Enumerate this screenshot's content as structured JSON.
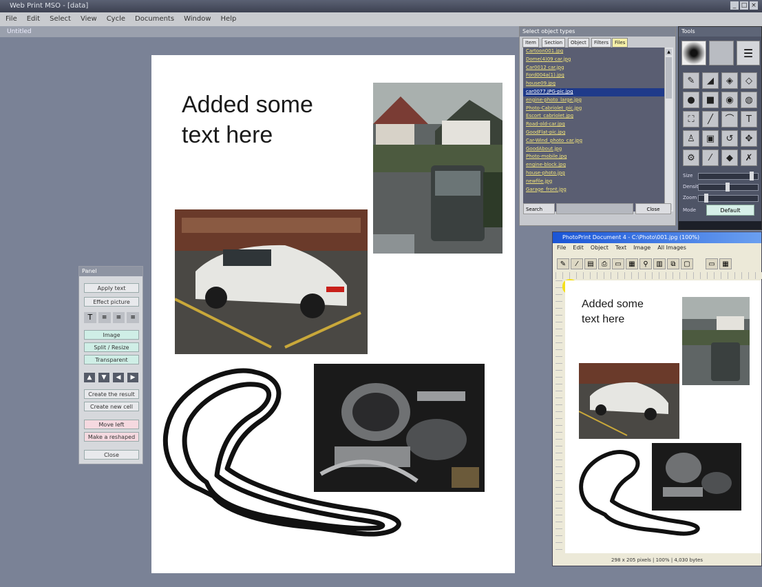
{
  "app": {
    "title": "Web Print MSO - [data]",
    "document_tab": "Untitled"
  },
  "menu": [
    "File",
    "Edit",
    "Select",
    "View",
    "Cycle",
    "Documents",
    "Window",
    "Help"
  ],
  "page": {
    "text": [
      "Added some",
      "text here"
    ]
  },
  "side_panel": {
    "title": "Panel",
    "buttons": [
      "Apply text",
      "Effect picture",
      "Image",
      "Split / Resize",
      "Transparent",
      "Create the result",
      "Create new cell",
      "Move left",
      "Make a reshaped",
      "Close"
    ],
    "arrows": [
      "▲",
      "▼",
      "◀",
      "▶"
    ]
  },
  "file_window": {
    "title": "Select object types",
    "tabs": [
      "Item",
      "Section",
      "Object",
      "Filters",
      "Files"
    ],
    "files": [
      "Cartoon001.jpg",
      "Dome(4)09 car.jpg",
      "Car0012 car.jpg",
      "Ford004a(1).jpg",
      "house09.jpg",
      "car0077.JPG-pic.jpg",
      "engine-photo_large.jpg",
      "Photo-Cabriolet_pic.jpg",
      "Escort_cabriolet.jpg",
      "Road-old-car.jpg",
      "GoodFlat-pic.jpg",
      "Car-Wind_photo_car.jpg",
      "GoodAbout.jpg",
      "Photo-mobile.jpg",
      "engine-block.jpg",
      "house-photo.jpg",
      "newfile.jpg",
      "Garage_front.jpg"
    ],
    "selected_index": 5,
    "search_label": "Search",
    "close_label": "Close"
  },
  "tools_window": {
    "title": "Tools",
    "sliders": [
      {
        "label": "Size",
        "value": 0.95
      },
      {
        "label": "Density",
        "value": 0.5
      },
      {
        "label": "Zoom",
        "value": 0.1
      }
    ],
    "option_label": "Mode",
    "option_value": "Default"
  },
  "preview_window": {
    "title": "PhotoPrint Document 4 - C:\\Photo\\001.jpg (100%)",
    "menu": [
      "File",
      "Edit",
      "Object",
      "Text",
      "Image",
      "All Images"
    ],
    "status": "298 x 205 pixels | 100% | 4,030 bytes",
    "page_text": [
      "Added some",
      "text here"
    ]
  },
  "colors": {
    "desktop": "#7a8296",
    "selection": "#1f3a8a",
    "list_text": "#f2e47a"
  }
}
